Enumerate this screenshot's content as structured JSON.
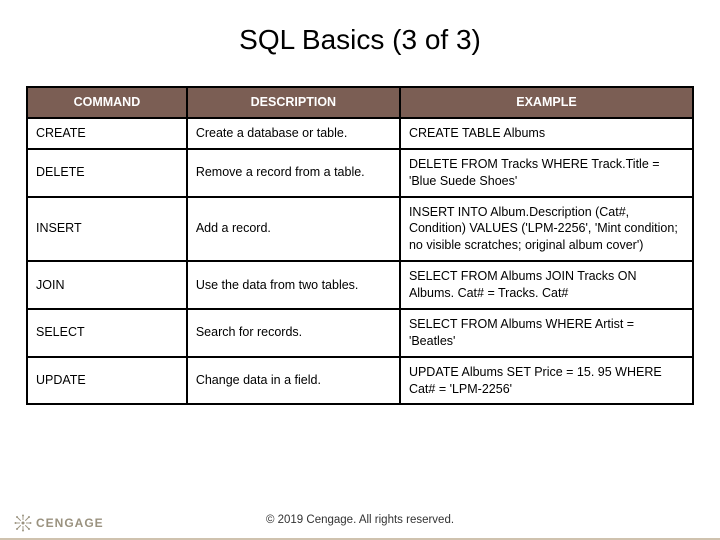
{
  "title": "SQL Basics (3 of 3)",
  "headers": {
    "c1": "COMMAND",
    "c2": "DESCRIPTION",
    "c3": "EXAMPLE"
  },
  "rows": [
    {
      "command": "CREATE",
      "description": "Create a database or table.",
      "example": "CREATE TABLE Albums"
    },
    {
      "command": "DELETE",
      "description": "Remove a record from a table.",
      "example": "DELETE FROM Tracks WHERE Track.Title = 'Blue Suede Shoes'"
    },
    {
      "command": "INSERT",
      "description": "Add a record.",
      "example": "INSERT INTO Album.Description (Cat#, Condition) VALUES ('LPM-2256', 'Mint condition; no visible scratches; original album cover')"
    },
    {
      "command": "JOIN",
      "description": "Use the data from two tables.",
      "example": "SELECT FROM Albums JOIN Tracks ON Albums. Cat# = Tracks. Cat#"
    },
    {
      "command": "SELECT",
      "description": "Search for records.",
      "example": "SELECT FROM Albums WHERE Artist = 'Beatles'"
    },
    {
      "command": "UPDATE",
      "description": "Change data in a field.",
      "example": "UPDATE Albums SET Price = 15. 95 WHERE Cat# = 'LPM-2256'"
    }
  ],
  "footer": {
    "copyright": "© 2019 Cengage. All rights reserved.",
    "brand": "CENGAGE"
  },
  "colors": {
    "header_bg": "#7b5e54"
  }
}
